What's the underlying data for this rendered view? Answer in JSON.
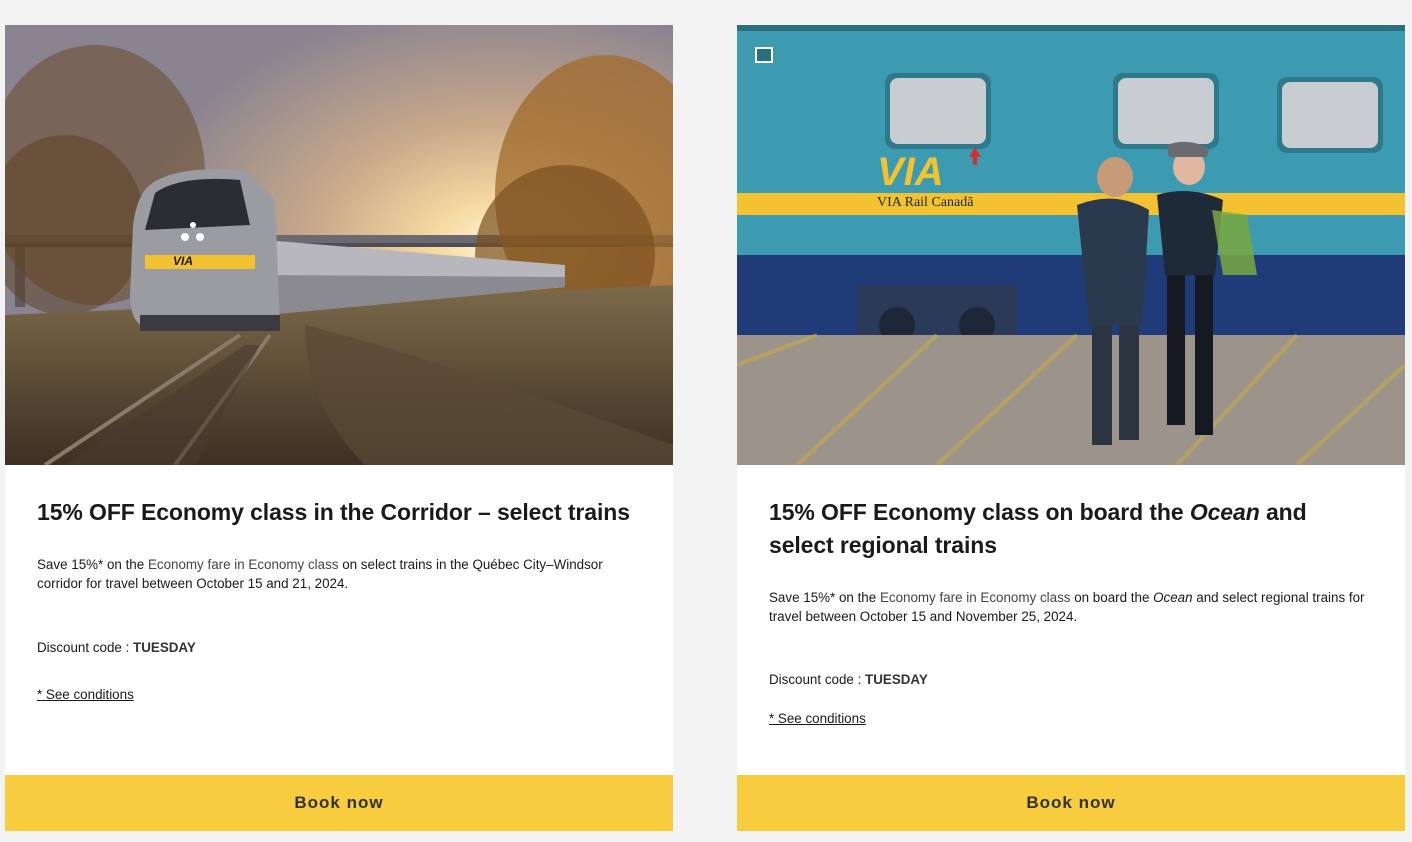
{
  "offers": [
    {
      "title_parts": [
        "15% OFF Economy class in the Corridor – select trains"
      ],
      "desc": {
        "save": "Save 15%* on the ",
        "fare": "Economy fare in Economy class",
        "rest": " on select trains in the Québec City–Windsor corridor for travel between October 15 and 21, 2024."
      },
      "code_label": "Discount code : ",
      "code_value": "TUESDAY",
      "conditions_label": "* See conditions",
      "book_label": "Book now",
      "image": "train-sunset-photo"
    },
    {
      "title_parts": [
        "15% OFF Economy class on board the ",
        "Ocean",
        " and select regional trains"
      ],
      "desc": {
        "save": "Save 15%* on the ",
        "fare": "Economy fare in Economy class",
        "mid": " on board the ",
        "ocean": "Ocean",
        "rest": " and select regional trains for travel between October 15 and November 25, 2024."
      },
      "code_label": "Discount code : ",
      "code_value": "TUESDAY",
      "conditions_label": "* See conditions",
      "book_label": "Book now",
      "image": "travellers-train-photo",
      "car_logo_text": "VIA",
      "car_logo_sub": "VIA Rail Canadā"
    }
  ],
  "colors": {
    "book_button": "#f7cc3e",
    "page_bg": "#f3f3f3",
    "card_bg": "#ffffff",
    "via_yellow": "#f2c230",
    "car_teal": "#3c9bb0"
  }
}
